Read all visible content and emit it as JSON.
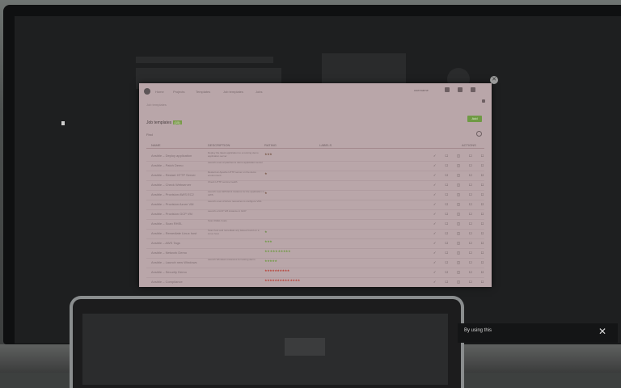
{
  "modal": {
    "title_prefix": "Job templates",
    "title_badge": "(15)",
    "add_label": "Add",
    "search_placeholder": "Find",
    "nav": [
      "Home",
      "Projects",
      "Templates",
      "Job templates",
      "Jobs"
    ],
    "nav_user": "username",
    "subtitle": "Job templates",
    "headers": [
      "NAME",
      "DESCRIPTION",
      "RATING",
      "LABELS",
      "ACTIONS"
    ]
  },
  "rows": [
    {
      "name": "Ansible – Deploy application",
      "desc": "Deploy the latest application to a running demo application server",
      "stars": "★★★",
      "stars_color": "#7a5a4a",
      "checks": "✓ ☐ ◫ ☐ ☐"
    },
    {
      "name": "Ansible – Patch Demo",
      "desc": "Launch a set of patches to demo application server",
      "stars": "",
      "stars_color": "#7a5a4a",
      "checks": "✓ ☐ ◫ ☐ ☐"
    },
    {
      "name": "Ansible – Restart HTTP Server",
      "desc": "Restart an Apache HTTP server on the demo environment",
      "stars": "★",
      "stars_color": "#7a5a4a",
      "checks": "✓ ☐ ◫ ☐ ☐"
    },
    {
      "name": "Ansible – Check Webserver",
      "desc": "Check HTTP service health",
      "stars": "",
      "stars_color": "#7a5a4a",
      "checks": "✓ ☐ ◫ ☐ ☐"
    },
    {
      "name": "Ansible – Provision AWS EC2",
      "desc": "Launch new AWS EC2 instance for the application in AWS",
      "stars": "★",
      "stars_color": "#7a5a4a",
      "checks": "✓ ☐ ◫ ☐ ☐"
    },
    {
      "name": "Ansible – Provision Azure VM",
      "desc": "Launch a set of Azure resources to configure VMs",
      "stars": "",
      "stars_color": "#7a5a4a",
      "checks": "✓ ☐ ◫ ☐ ☐"
    },
    {
      "name": "Ansible – Provision GCP VM",
      "desc": "Launch a GCP VM instance in GCP",
      "stars": "",
      "stars_color": "#7a5a4a",
      "checks": "✓ ☐ ◫ ☐ ☐"
    },
    {
      "name": "Ansible – Scan RHEL",
      "desc": "Scan RHEL hosts",
      "stars": "",
      "stars_color": "#7a5a4a",
      "checks": "✓ ☐ ◫ ☐ ☐"
    },
    {
      "name": "Ansible – Remediate Linux host",
      "desc": "Scan host and remediate any issues found on a Linux host",
      "stars": "★",
      "stars_color": "#6d8a4a",
      "checks": "✓ ☐ ◫ ☐ ☐"
    },
    {
      "name": "Ansible – AWS Tags",
      "desc": "",
      "stars": "★★★",
      "stars_color": "#6f9a44",
      "checks": "✓ ☐ ◫ ☐ ☐"
    },
    {
      "name": "Ansible – Network Demo",
      "desc": "",
      "stars": "★★       ★★★ ★★★★★",
      "stars_color": "#6f9a44",
      "checks": "✓ ☐ ◫ ☐ ☐"
    },
    {
      "name": "Ansible – Launch new Windows",
      "desc": "Launch Windows instances for testing demo",
      "stars": "★★★★★",
      "stars_color": "#6f9a44",
      "checks": "✓ ☐ ◫ ☐ ☐"
    },
    {
      "name": "Ansible – Security Demo",
      "desc": "",
      "stars": "★★★★★★★★★★",
      "stars_color": "#b8443a",
      "checks": "✓ ☐ ◫ ☐ ☐"
    },
    {
      "name": "Ansible – Compliance",
      "desc": "",
      "stars": "★★★★★★★★★★ ★★★★",
      "stars_color": "#b8443a",
      "checks": "✓ ☐ ◫ ☐ ☐"
    }
  ],
  "cookie": {
    "text": "By using this",
    "close": "✕"
  }
}
